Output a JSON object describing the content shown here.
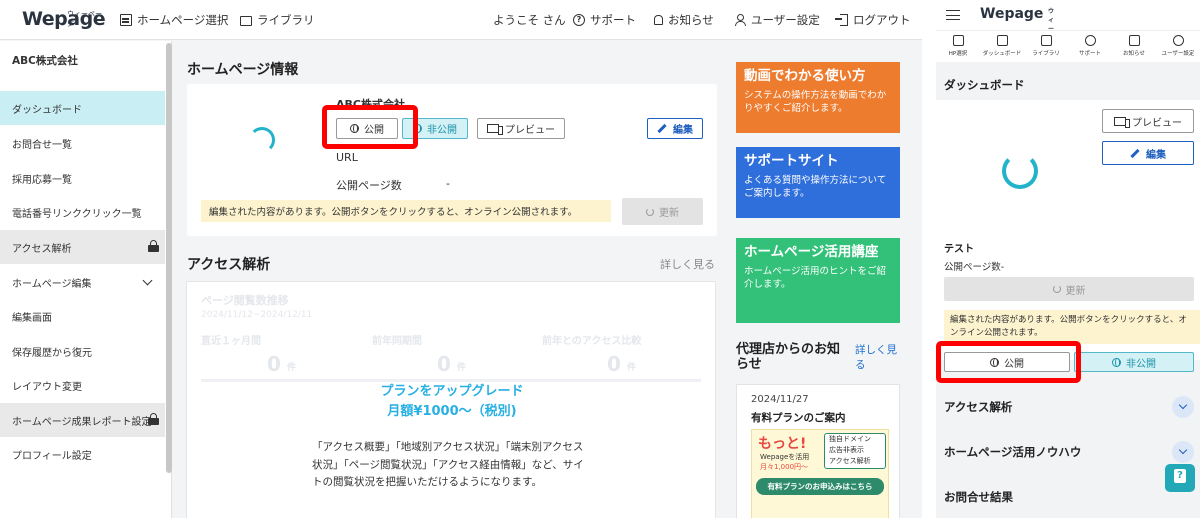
{
  "header": {
    "logo": "Wepage",
    "logo_sub": "ウィーページ",
    "nav": [
      {
        "label": "ホームページ選択"
      },
      {
        "label": "ライブラリ"
      }
    ],
    "welcome": "ようこそ さん",
    "support": "サポート",
    "notice": "お知らせ",
    "user_settings": "ユーザー設定",
    "logout": "ログアウト"
  },
  "sidebar": {
    "company": "ABC株式会社",
    "items": [
      {
        "label": "ダッシュボード"
      },
      {
        "label": "お問合せ一覧"
      },
      {
        "label": "採用応募一覧"
      },
      {
        "label": "電話番号リンククリック一覧"
      },
      {
        "label": "アクセス解析"
      },
      {
        "label": "ホームページ編集"
      },
      {
        "label": "編集画面"
      },
      {
        "label": "保存履歴から復元"
      },
      {
        "label": "レイアウト変更"
      },
      {
        "label": "ホームページ成果レポート設定"
      },
      {
        "label": "プロフィール設定"
      }
    ]
  },
  "hp_info": {
    "title": "ホームページ情報",
    "company": "ABC株式会社",
    "public_btn": "公開",
    "private_btn": "非公開",
    "preview_btn": "プレビュー",
    "edit_btn": "編集",
    "url_label": "URL",
    "page_count_label": "公開ページ数",
    "page_count_value": "-",
    "warning": "編集された内容があります。公開ボタンをクリックすると、オンライン公開されます。",
    "update_btn": "更新"
  },
  "access": {
    "title": "アクセス解析",
    "more": "詳しく見る",
    "faded_title": "ページ閲覧数推移",
    "faded_range": "2024/11/12~2024/12/11",
    "faded_cols": [
      "直近１ヶ月間",
      "前年同期間",
      "前年とのアクセス比較"
    ],
    "faded_value": "0",
    "faded_unit": "件",
    "upgrade_line1": "プランをアップグレード",
    "upgrade_line2": "月額¥1000～（税別)",
    "upgrade_desc": "「アクセス概要」「地域別アクセス状況」「端末別アクセス状況」「ページ閲覧状況」「アクセス経由情報」など、サイトの閲覧状況を把握いただけるようになります。"
  },
  "banners": [
    {
      "title": "動画でわかる使い方",
      "desc": "システムの操作方法を動画でわかりやすくご紹介します。",
      "color": "#ee7c2f"
    },
    {
      "title": "サポートサイト",
      "desc": "よくある質問や操作方法についてご案内します。",
      "color": "#2f6fdc"
    },
    {
      "title": "ホームページ活用講座",
      "desc": "ホームページ活用のヒントをご紹介します。",
      "color": "#33c17a"
    }
  ],
  "agency": {
    "title": "代理店からのお知らせ",
    "more": "詳しく見る",
    "date": "2024/11/27",
    "headline": "有料プランのご案内",
    "promo_big": "もっと!",
    "promo_sub": "Wepageを活用",
    "promo_price": "月々1,000円～",
    "promo_features": [
      "独自ドメイン",
      "広告非表示",
      "アクセス解析"
    ],
    "promo_cta": "有料プランのお申込みはこちら"
  },
  "mobile": {
    "logo": "Wepage",
    "logo_sub": "ウィーページ",
    "nav": [
      "HP選択",
      "ダッシュボード",
      "ライブラリ",
      "サポート",
      "お知らせ",
      "ユーザー設定"
    ],
    "dashboard_title": "ダッシュボード",
    "preview_btn": "プレビュー",
    "edit_btn": "編集",
    "site_name": "テスト",
    "page_count": "公開ページ数-",
    "update_btn": "更新",
    "warning": "編集された内容があります。公開ボタンをクリックすると、オンライン公開されます。",
    "public_btn": "公開",
    "private_btn": "非公開",
    "sections": [
      "アクセス解析",
      "ホームページ活用ノウハウ",
      "お問合せ結果"
    ]
  }
}
